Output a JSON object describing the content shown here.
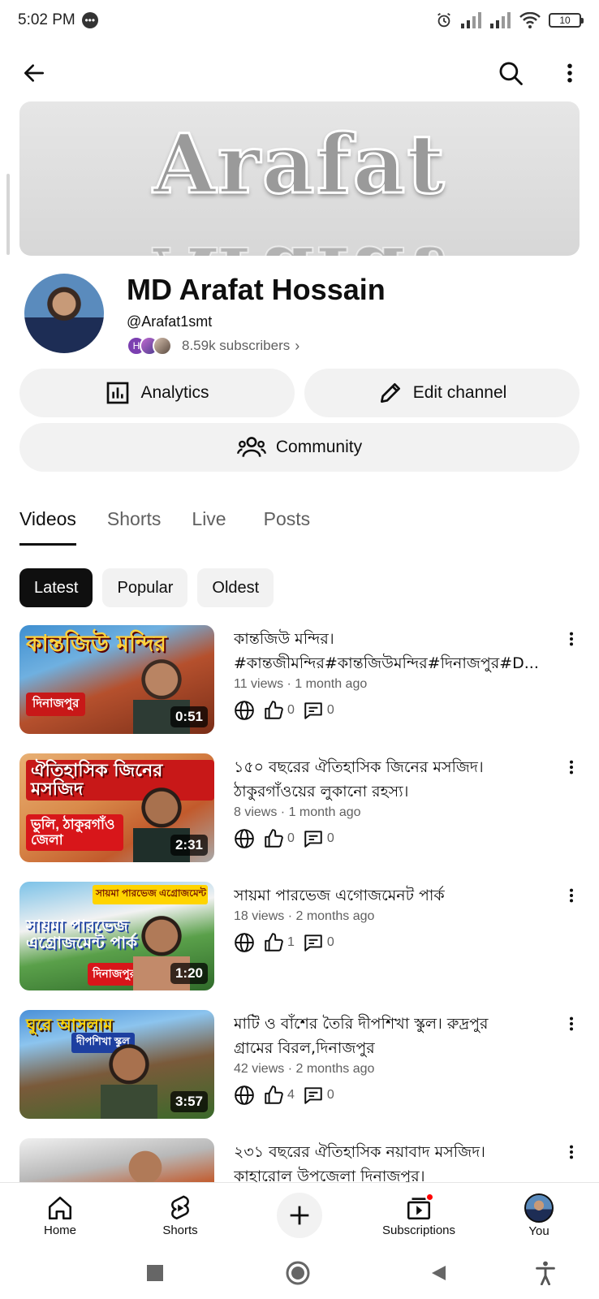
{
  "status_bar": {
    "time": "5:02 PM",
    "battery": "10",
    "chat_badge": "•••"
  },
  "top_bar": {
    "back": "back-arrow-icon",
    "search": "search-icon",
    "more": "more-vert-icon"
  },
  "banner": {
    "text": "Arafat",
    "reflection": "Arafat"
  },
  "channel": {
    "name": "MD Arafat Hossain",
    "handle": "@Arafat1smt",
    "subscribers": "8.59k subscribers",
    "subscribers_chevron": "›",
    "mini_avatar_letter": "H"
  },
  "actions": {
    "analytics": "Analytics",
    "edit_channel": "Edit channel",
    "community": "Community"
  },
  "tabs": [
    {
      "label": "Videos",
      "active": true
    },
    {
      "label": "Shorts",
      "active": false
    },
    {
      "label": "Live",
      "active": false
    },
    {
      "label": "Posts",
      "active": false
    }
  ],
  "chips": [
    {
      "label": "Latest",
      "active": true
    },
    {
      "label": "Popular",
      "active": false
    },
    {
      "label": "Oldest",
      "active": false
    }
  ],
  "videos": [
    {
      "thumb_text": "কান্তজিউ মন্দির",
      "thumb_sub": "দিনাজপুর",
      "duration": "0:51",
      "title_line1": "কান্তজিউ মন্দির।",
      "title_line2": "#কান্তজীমন্দির#কান্তজিউমন্দির#দিনাজপুর#D...",
      "meta": "11 views · 1 month ago",
      "likes": "0",
      "comments": "0"
    },
    {
      "thumb_text": "ঐতিহাসিক জিনের মসজিদ",
      "thumb_sub": "ভুলি, ঠাকুরগাঁও জেলা",
      "duration": "2:31",
      "title_line1": "১৫০ বছরের ঐতিহাসিক জিনের মসজিদ।",
      "title_line2": "ঠাকুরগাঁওয়ের লুকানো রহস্য।",
      "meta": "8 views · 1 month ago",
      "likes": "0",
      "comments": "0"
    },
    {
      "thumb_text": "সায়মা পারভেজ এগ্রোজমেন্ট পার্ক",
      "thumb_sub": "দিনাজপুর",
      "duration": "1:20",
      "title_line1": "সায়মা পারভেজ এগোজমেনট পার্ক",
      "title_line2": "",
      "meta": "18 views · 2 months ago",
      "likes": "1",
      "comments": "0"
    },
    {
      "thumb_text": "ঘুরে আসলাম",
      "thumb_sub": "দীপশিখা স্কুল",
      "duration": "3:57",
      "title_line1": "মাটি ও বাঁশের তৈরি দীপশিখা স্কুল। রুদ্রপুর",
      "title_line2": "গ্রামের বিরল,দিনাজপুর",
      "meta": "42 views · 2 months ago",
      "likes": "4",
      "comments": "0"
    },
    {
      "thumb_text": "",
      "thumb_sub": "",
      "duration": "",
      "title_line1": "২৩১ বছরের ঐতিহাসিক নয়াবাদ মসজিদ।",
      "title_line2": "কাহারোল উপজেলা দিনাজপুর।",
      "meta": "",
      "likes": "",
      "comments": ""
    }
  ],
  "bottom_nav": {
    "home": "Home",
    "shorts": "Shorts",
    "create": "add-icon",
    "subscriptions": "Subscriptions",
    "you": "You"
  },
  "colors": {
    "chip_active_bg": "#0f0f0f",
    "pill_bg": "#f2f2f2",
    "secondary_text": "#606060",
    "notification_red": "#ff0000"
  }
}
